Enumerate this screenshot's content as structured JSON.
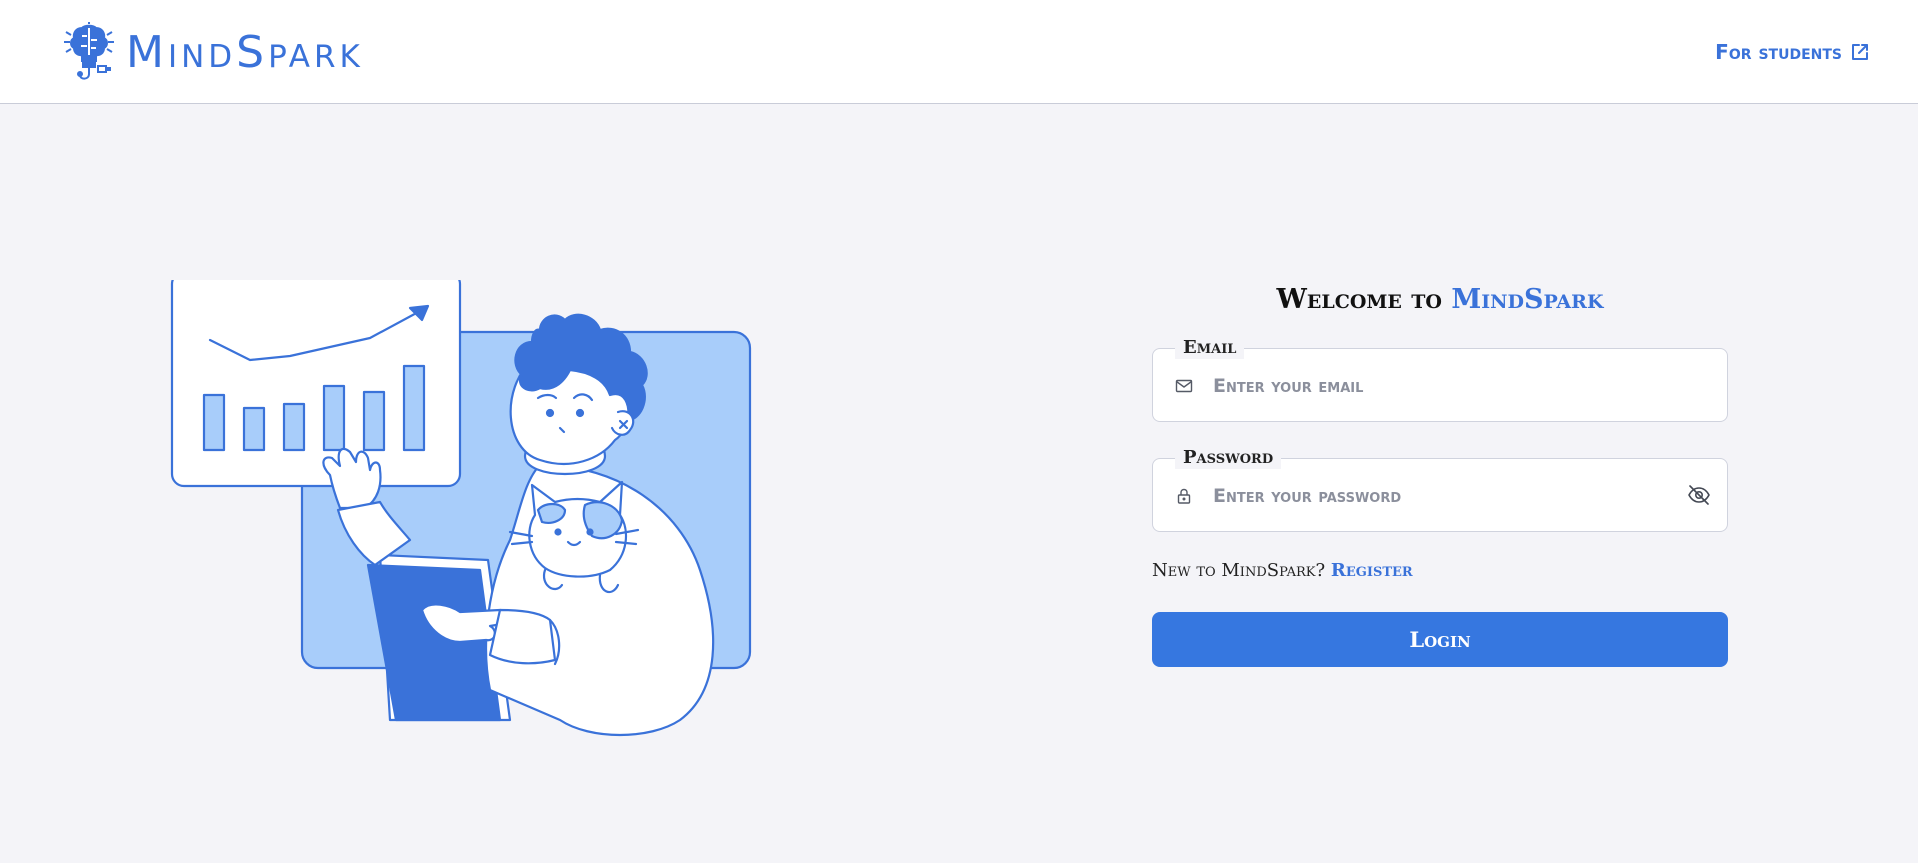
{
  "header": {
    "brand": "MindSpark",
    "for_students_label": "For students"
  },
  "welcome": {
    "prefix": "Welcome to",
    "brand": "MindSpark"
  },
  "form": {
    "email": {
      "label": "Email",
      "placeholder": "Enter your email",
      "value": ""
    },
    "password": {
      "label": "Password",
      "placeholder": "Enter your password",
      "value": ""
    },
    "register_prompt": "New to MindSpark?",
    "register_link": "Register",
    "login_label": "Login"
  },
  "icons": {
    "logo": "lightbulb-brain-icon",
    "external": "external-link-icon",
    "email": "mail-icon",
    "password": "lock-icon",
    "toggle_visibility": "eye-off-icon"
  },
  "colors": {
    "brand": "#3a72d9",
    "button": "#3677e0",
    "background": "#f4f4f8",
    "illustration_fill": "#a8cdfa"
  }
}
